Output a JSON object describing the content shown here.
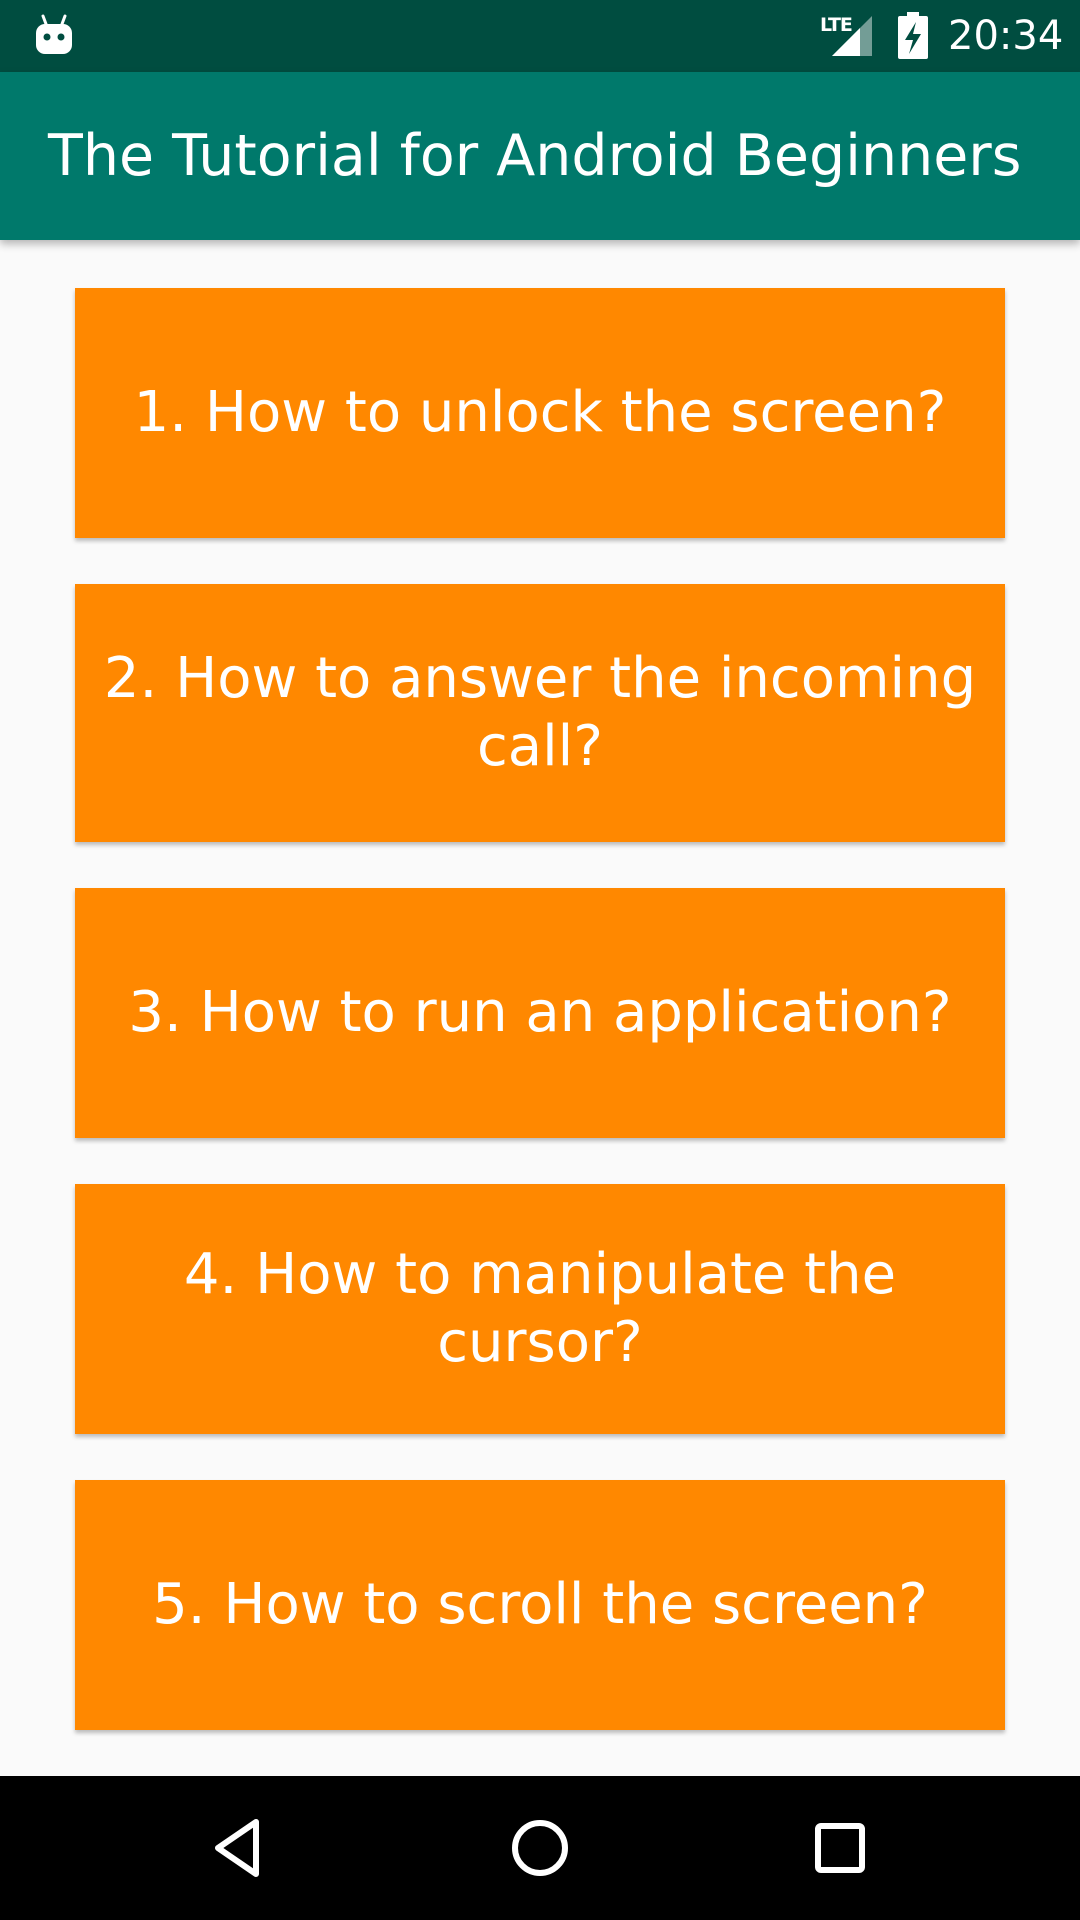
{
  "status_bar": {
    "network": "LTE",
    "time": "20:34"
  },
  "app_bar": {
    "title": "The Tutorial for Android Beginners"
  },
  "tutorials": [
    {
      "label": "1. How to unlock the screen?"
    },
    {
      "label": "2. How to answer the incoming call?"
    },
    {
      "label": "3. How to run an application?"
    },
    {
      "label": "4. How to manipulate the cursor?"
    },
    {
      "label": "5. How to scroll the screen?"
    }
  ],
  "nav_bar": {
    "icons": [
      "back-icon",
      "home-icon",
      "recents-icon"
    ]
  },
  "colors": {
    "status_bar": "#004d40",
    "app_bar": "#00796b",
    "button": "#ff8800",
    "background": "#fafafa"
  }
}
